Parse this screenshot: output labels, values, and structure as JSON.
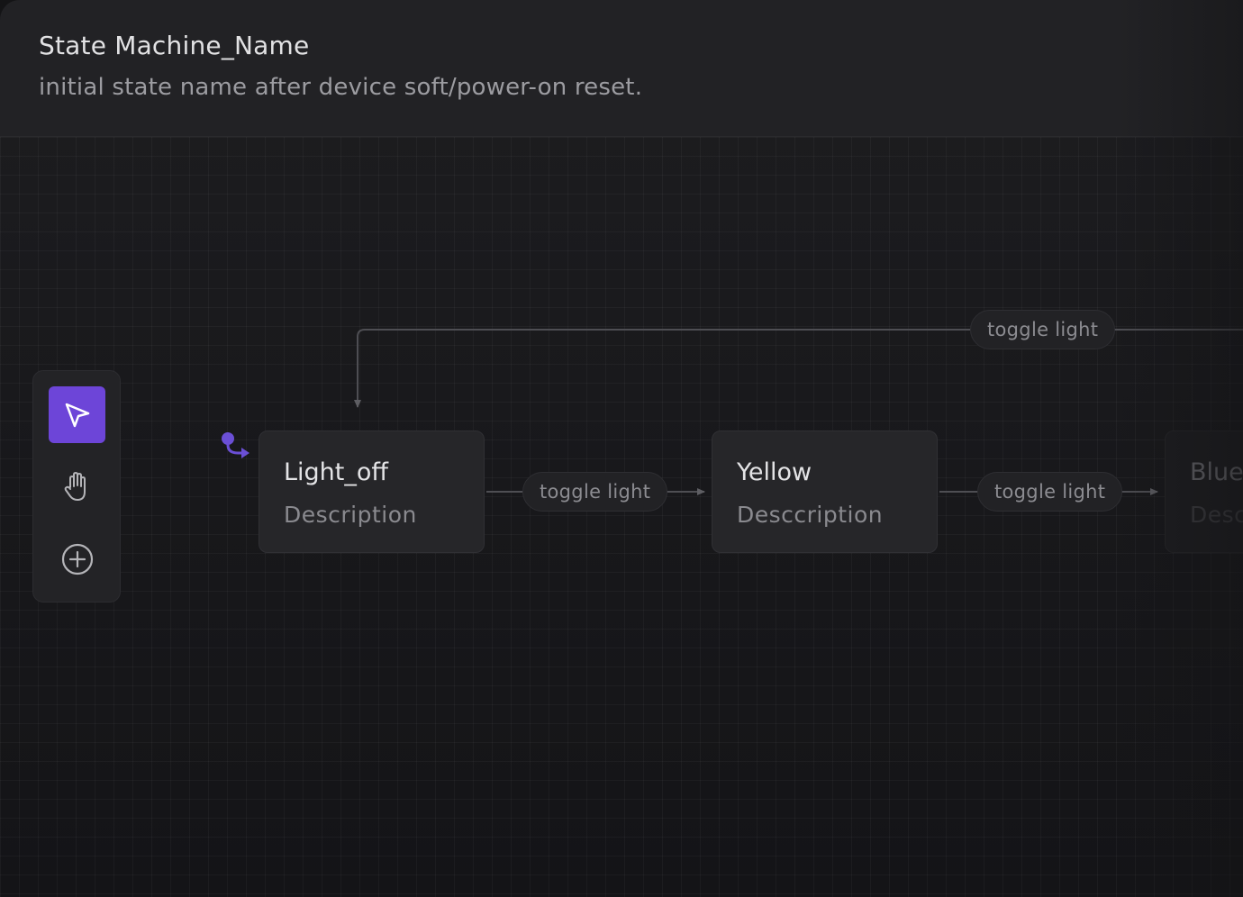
{
  "header": {
    "title": "State Machine_Name",
    "subtitle": "initial state name after device soft/power-on reset."
  },
  "toolbar": {
    "tools": [
      {
        "name": "select",
        "icon": "cursor-icon",
        "active": true
      },
      {
        "name": "pan",
        "icon": "hand-icon",
        "active": false
      },
      {
        "name": "add",
        "icon": "plus-circle-icon",
        "active": false
      }
    ]
  },
  "states": [
    {
      "name": "Light_off",
      "description": "Description"
    },
    {
      "name": "Yellow",
      "description": "Desccription"
    },
    {
      "name": "Blue",
      "description": "Description"
    }
  ],
  "transitions": [
    {
      "label": "toggle light",
      "from": "Light_off",
      "to": "Yellow"
    },
    {
      "label": "toggle light",
      "from": "Yellow",
      "to": "Blue"
    },
    {
      "label": "toggle light",
      "from": "Blue",
      "to": "Light_off"
    }
  ],
  "colors": {
    "accent": "#6d45d8",
    "initial_marker": "#6b4fd6",
    "background": "#141416",
    "node": "#262629",
    "edge": "#5a5a5f"
  }
}
